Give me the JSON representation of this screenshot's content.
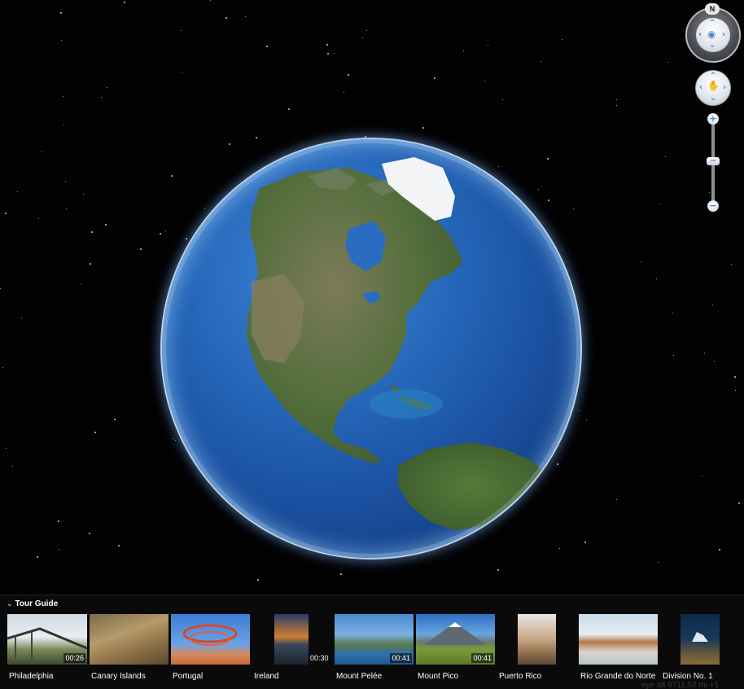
{
  "map": {
    "view": "globe",
    "region_centered": "North America",
    "compass_letter": "N",
    "coords_text": "eye alt 9711.52 mi  +1"
  },
  "controls": {
    "zoom_in": "+",
    "zoom_out": "−",
    "zoom_thumb": "−"
  },
  "tour_guide": {
    "title": "Tour Guide",
    "items": [
      {
        "label": "Philadelphia",
        "duration": "00:26"
      },
      {
        "label": "Canary Islands",
        "duration": ""
      },
      {
        "label": "Portugal",
        "duration": ""
      },
      {
        "label": "Ireland",
        "duration": "00:30"
      },
      {
        "label": "Mount Pelée",
        "duration": "00:41"
      },
      {
        "label": "Mount Pico",
        "duration": "00:41"
      },
      {
        "label": "Puerto Rico",
        "duration": ""
      },
      {
        "label": "Rio Grande do Norte",
        "duration": ""
      },
      {
        "label": "Division No. 1",
        "duration": ""
      }
    ]
  },
  "colors": {
    "space": "#020203",
    "ocean": "#2566b8",
    "land": "#4f6b3a",
    "ice": "#f2f4f6",
    "control_accent": "#4a86c9"
  }
}
